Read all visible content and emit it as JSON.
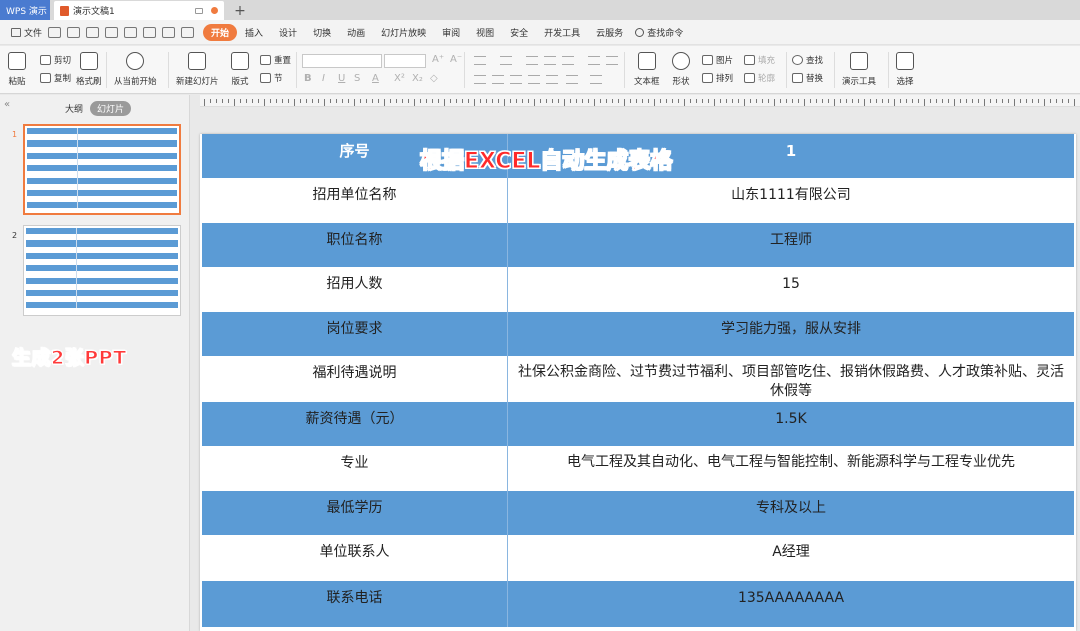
{
  "tabbar": {
    "app_tab": "WPS 演示",
    "doc_tab": "演示文稿1",
    "add": "+"
  },
  "menubar": {
    "file": "文件",
    "menus": [
      "开始",
      "插入",
      "设计",
      "切换",
      "动画",
      "幻灯片放映",
      "审阅",
      "视图",
      "安全",
      "开发工具",
      "云服务"
    ],
    "active_menu": "开始",
    "search": "查找命令"
  },
  "ribbon": {
    "paste": "粘贴",
    "cut": "剪切",
    "copy": "复制",
    "format_painter": "格式刷",
    "from_current": "从当前开始",
    "new_slide": "新建幻灯片",
    "layout": "版式",
    "reset": "重置",
    "section": "节",
    "textbox": "文本框",
    "shape": "形状",
    "picture": "图片",
    "arrange": "排列",
    "fill": "填充",
    "outline": "轮廓",
    "find": "查找",
    "replace": "替换",
    "present_tools": "演示工具",
    "select": "选择"
  },
  "leftpanel": {
    "collapse": "«",
    "tab_outline": "大纲",
    "tab_slides": "幻灯片",
    "slide_numbers": [
      "1",
      "2"
    ],
    "annotation": "生成2张PPT"
  },
  "slide": {
    "overlay_title": "根据EXCEL自动生成表格",
    "rows": [
      {
        "label": "序号",
        "value": "1"
      },
      {
        "label": "招用单位名称",
        "value": "山东1111有限公司"
      },
      {
        "label": "职位名称",
        "value": "工程师"
      },
      {
        "label": "招用人数",
        "value": "15"
      },
      {
        "label": "岗位要求",
        "value": "学习能力强，服从安排"
      },
      {
        "label": "福利待遇说明",
        "value": "社保公积金商险、过节费过节福利、项目部管吃住、报销休假路费、人才政策补贴、灵活休假等"
      },
      {
        "label": "薪资待遇（元）",
        "value": "1.5K"
      },
      {
        "label": "专业",
        "value": "电气工程及其自动化、电气工程与智能控制、新能源科学与工程专业优先"
      },
      {
        "label": "最低学历",
        "value": "专科及以上"
      },
      {
        "label": "单位联系人",
        "value": "A经理"
      },
      {
        "label": "联系电话",
        "value": "135AAAAAAAA"
      }
    ]
  },
  "colors": {
    "accent": "#f07b3f",
    "table_blue": "#5b9bd5",
    "annotation_red": "#ff2a2a",
    "wps_blue": "#4a7bd0"
  }
}
